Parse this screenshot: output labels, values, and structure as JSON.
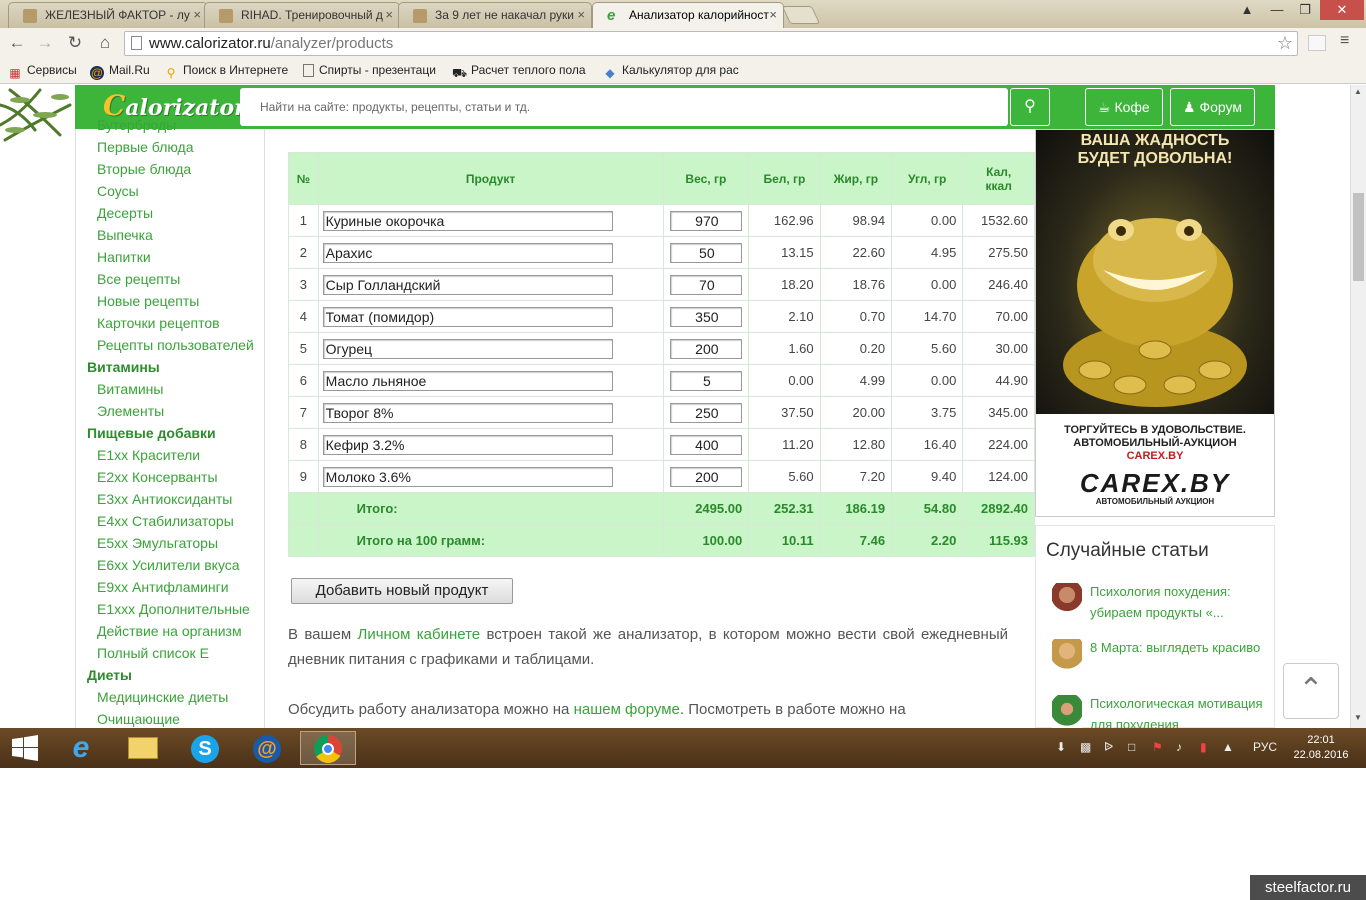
{
  "browser": {
    "tabs": [
      {
        "title": "ЖЕЛЕЗНЫЙ ФАКТОР - лу",
        "active": false
      },
      {
        "title": "RIHAD. Тренировочный д",
        "active": false
      },
      {
        "title": "За 9 лет не накачал руки",
        "active": false
      },
      {
        "title": "Анализатор калорийност",
        "active": true
      }
    ],
    "tab_close": "×",
    "url_domain": "www.calorizator.ru",
    "url_path": "/analyzer/products",
    "bookmarks": [
      {
        "label": "Сервисы",
        "icon": "apps-icon"
      },
      {
        "label": "Mail.Ru",
        "icon": "mailru-icon"
      },
      {
        "label": "Поиск в Интернете",
        "icon": "search-icon"
      },
      {
        "label": "Спирты - презентаци",
        "icon": "document-icon"
      },
      {
        "label": "Расчет теплого пола",
        "icon": "car-icon"
      },
      {
        "label": "Калькулятор для рас",
        "icon": "drop-icon"
      }
    ]
  },
  "site": {
    "logo_c": "C",
    "logo_rest": "alorizator",
    "search_placeholder": "Найти на сайте: продукты, рецепты, статьи и тд.",
    "coffee_label": "Кофе",
    "forum_label": "Форум"
  },
  "sidebar": [
    {
      "label": "Бутерброды",
      "type": "item"
    },
    {
      "label": "Первые блюда",
      "type": "item"
    },
    {
      "label": "Вторые блюда",
      "type": "item"
    },
    {
      "label": "Соусы",
      "type": "item"
    },
    {
      "label": "Десерты",
      "type": "item"
    },
    {
      "label": "Выпечка",
      "type": "item"
    },
    {
      "label": "Напитки",
      "type": "item"
    },
    {
      "label": "Все рецепты",
      "type": "item"
    },
    {
      "label": "Новые рецепты",
      "type": "item"
    },
    {
      "label": "Карточки рецептов",
      "type": "item"
    },
    {
      "label": "Рецепты пользователей",
      "type": "item"
    },
    {
      "label": "Витамины",
      "type": "cat"
    },
    {
      "label": "Витамины",
      "type": "item"
    },
    {
      "label": "Элементы",
      "type": "item"
    },
    {
      "label": "Пищевые добавки",
      "type": "cat"
    },
    {
      "label": "E1xx Красители",
      "type": "item"
    },
    {
      "label": "E2xx Консерванты",
      "type": "item"
    },
    {
      "label": "E3xx Антиоксиданты",
      "type": "item"
    },
    {
      "label": "E4xx Стабилизаторы",
      "type": "item"
    },
    {
      "label": "E5xx Эмульгаторы",
      "type": "item"
    },
    {
      "label": "E6xx Усилители вкуса",
      "type": "item"
    },
    {
      "label": "E9xx Антифламинги",
      "type": "item"
    },
    {
      "label": "E1xxx Дополнительные",
      "type": "item"
    },
    {
      "label": "Действие на организм",
      "type": "item"
    },
    {
      "label": "Полный список E",
      "type": "item"
    },
    {
      "label": "Диеты",
      "type": "cat"
    },
    {
      "label": "Медицинские диеты",
      "type": "item"
    },
    {
      "label": "Очищающие",
      "type": "item"
    }
  ],
  "table": {
    "headers": [
      "№",
      "Продукт",
      "Вес, гр",
      "Бел, гр",
      "Жир, гр",
      "Угл, гр",
      "Кал, ккал"
    ],
    "rows": [
      {
        "n": "1",
        "product": "Куриные окорочка",
        "weight": "970",
        "protein": "162.96",
        "fat": "98.94",
        "carb": "0.00",
        "kcal": "1532.60"
      },
      {
        "n": "2",
        "product": "Арахис",
        "weight": "50",
        "protein": "13.15",
        "fat": "22.60",
        "carb": "4.95",
        "kcal": "275.50"
      },
      {
        "n": "3",
        "product": "Сыр Голландский",
        "weight": "70",
        "protein": "18.20",
        "fat": "18.76",
        "carb": "0.00",
        "kcal": "246.40"
      },
      {
        "n": "4",
        "product": "Томат (помидор)",
        "weight": "350",
        "protein": "2.10",
        "fat": "0.70",
        "carb": "14.70",
        "kcal": "70.00"
      },
      {
        "n": "5",
        "product": "Огурец",
        "weight": "200",
        "protein": "1.60",
        "fat": "0.20",
        "carb": "5.60",
        "kcal": "30.00"
      },
      {
        "n": "6",
        "product": "Масло льняное",
        "weight": "5",
        "protein": "0.00",
        "fat": "4.99",
        "carb": "0.00",
        "kcal": "44.90"
      },
      {
        "n": "7",
        "product": "Творог 8%",
        "weight": "250",
        "protein": "37.50",
        "fat": "20.00",
        "carb": "3.75",
        "kcal": "345.00"
      },
      {
        "n": "8",
        "product": "Кефир 3.2%",
        "weight": "400",
        "protein": "11.20",
        "fat": "12.80",
        "carb": "16.40",
        "kcal": "224.00"
      },
      {
        "n": "9",
        "product": "Молоко 3.6%",
        "weight": "200",
        "protein": "5.60",
        "fat": "7.20",
        "carb": "9.40",
        "kcal": "124.00"
      }
    ],
    "total": {
      "label": "Итого:",
      "weight": "2495.00",
      "protein": "252.31",
      "fat": "186.19",
      "carb": "54.80",
      "kcal": "2892.40"
    },
    "per100": {
      "label": "Итого на 100 грамм:",
      "weight": "100.00",
      "protein": "10.11",
      "fat": "7.46",
      "carb": "2.20",
      "kcal": "115.93"
    }
  },
  "add_button": "Добавить новый продукт",
  "para1": {
    "before": "В вашем ",
    "link": "Личном кабинете",
    "after": " встроен такой же анализатор, в котором можно вести свой ежедневный дневник питания с графиками и таблицами."
  },
  "para2": {
    "before": "Обсудить работу анализатора можно на ",
    "link": "нашем форуме",
    "after": ". Посмотреть в работе можно на"
  },
  "ad": {
    "headline": "ВАША ЖАДНОСТЬ БУДЕТ ДОВОЛЬНА!",
    "tagline": "ТОРГУЙТЕСЬ В УДОВОЛЬСТВИЕ. АВТОМОБИЛЬНЫЙ-АУКЦИОН",
    "site": "CAREX.BY",
    "logo": "CAREX.BY",
    "logo_sub": "АВТОМОБИЛЬНЫЙ АУКЦИОН"
  },
  "random": {
    "title": "Случайные статьи",
    "articles": [
      "Психология похудения: убираем продукты «...",
      "8 Марта: выглядеть красиво",
      "Психологическая мотивация для похудения"
    ]
  },
  "taskbar": {
    "lang": "РУС",
    "time": "22:01",
    "date": "22.08.2016"
  },
  "watermark": "steelfactor.ru"
}
